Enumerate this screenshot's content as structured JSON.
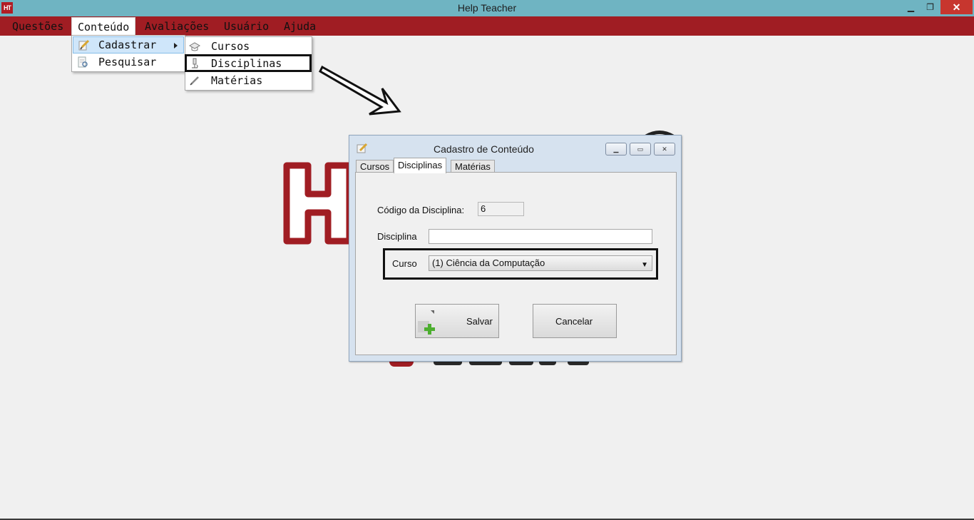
{
  "window": {
    "title": "Help Teacher",
    "app_icon_text": "HT",
    "minimize_glyph": "▁",
    "restore_glyph": "❐",
    "close_glyph": "✕"
  },
  "menubar": {
    "items": [
      "Questões",
      "Conteúdo",
      "Avaliações",
      "Usuário",
      "Ajuda"
    ],
    "active": "Conteúdo"
  },
  "conteudo_menu": {
    "items": [
      {
        "label": "Cadastrar",
        "icon": "pencil-note-icon",
        "has_submenu": true,
        "highlighted": true
      },
      {
        "label": "Pesquisar",
        "icon": "document-search-icon",
        "has_submenu": false,
        "highlighted": false
      }
    ]
  },
  "cadastrar_submenu": {
    "items": [
      {
        "label": "Cursos",
        "icon": "graduation-cap-icon"
      },
      {
        "label": "Disciplinas",
        "icon": "microscope-icon",
        "outlined": true
      },
      {
        "label": "Matérias",
        "icon": "pencil-icon"
      }
    ]
  },
  "dialog": {
    "title": "Cadastro de Conteúdo",
    "tabs": [
      "Cursos",
      "Disciplinas",
      "Matérias"
    ],
    "active_tab": "Disciplinas",
    "codigo_label": "Código da Disciplina:",
    "codigo_value": "6",
    "disciplina_label": "Disciplina",
    "disciplina_value": "",
    "curso_label": "Curso",
    "curso_selected": "(1) Ciência da Computação",
    "save_label": "Salvar",
    "cancel_label": "Cancelar"
  },
  "colors": {
    "titlebar": "#6fb4c2",
    "menubar": "#a01d23",
    "brand_red": "#a01d23",
    "close_button": "#c7362e",
    "dialog_frame": "#d6e2ef"
  }
}
